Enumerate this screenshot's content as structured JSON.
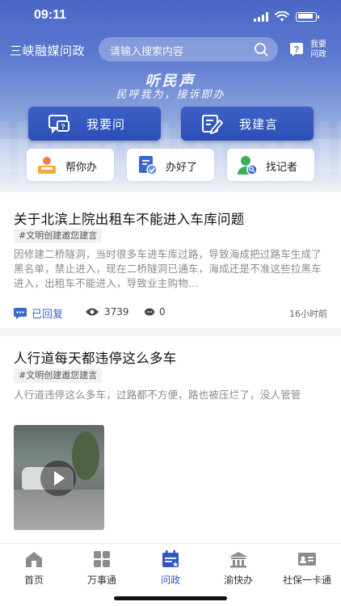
{
  "status_bar": {
    "time": "09:11"
  },
  "header": {
    "app_title": "三峡融媒问政",
    "search_placeholder": "请输入搜索内容",
    "help_label": "我要问政"
  },
  "banner": {
    "slogan_main": "听民声",
    "slogan_sub": "民呼我为，接诉即办"
  },
  "primary_actions": [
    {
      "label": "我要问"
    },
    {
      "label": "我建言"
    }
  ],
  "secondary_actions": [
    {
      "label": "帮你办"
    },
    {
      "label": "办好了"
    },
    {
      "label": "找记者"
    }
  ],
  "posts": [
    {
      "title": "关于北滨上院出租车不能进入车库问题",
      "tag": "#文明创建邀您建言",
      "excerpt": "因修建二桥隧洞，当时很多车进车库过路，导致海成把过路车生成了黑名单，禁止进入，现在二桥隧洞已通车，海成还是不准这些拉黑车进入，出租车不能进入，导致业主购物...",
      "status": "已回复",
      "views": "3739",
      "comments": "0",
      "time": "16小时前"
    },
    {
      "title": "人行道每天都违停这么多车",
      "tag": "#文明创建邀您建言",
      "excerpt": "人行道违停这么多车，过路都不方便，路也被压烂了，没人管管"
    }
  ],
  "tabbar": {
    "items": [
      {
        "label": "首页",
        "icon": "home-icon"
      },
      {
        "label": "万事通",
        "icon": "grid-icon"
      },
      {
        "label": "问政",
        "icon": "calendar-icon",
        "active": true
      },
      {
        "label": "渝快办",
        "icon": "building-icon"
      },
      {
        "label": "社保一卡通",
        "icon": "card-icon"
      }
    ]
  },
  "colors": {
    "brand_blue": "#2b4fb6",
    "active_tab": "#2f58c5",
    "replied_blue": "#3b66cf"
  }
}
